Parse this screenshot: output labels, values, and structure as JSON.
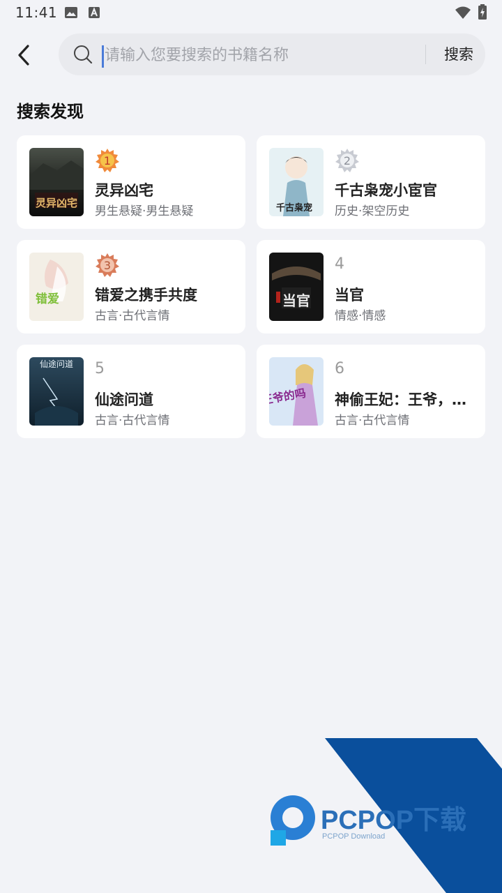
{
  "status_bar": {
    "time": "11:41"
  },
  "search": {
    "placeholder": "请输入您要搜索的书籍名称",
    "value": "",
    "button_label": "搜索"
  },
  "section_title": "搜索发现",
  "books": [
    {
      "rank": "1",
      "title": "灵异凶宅",
      "tags": "男生悬疑·男生悬疑",
      "cover_text": "灵异凶宅"
    },
    {
      "rank": "2",
      "title": "千古枭宠小宦官",
      "tags": "历史·架空历史",
      "cover_text": "千古枭宠"
    },
    {
      "rank": "3",
      "title": "错爱之携手共度",
      "tags": "古言·古代言情",
      "cover_text": "错爱"
    },
    {
      "rank": "4",
      "title": "当官",
      "tags": "情感·情感",
      "cover_text": "当官"
    },
    {
      "rank": "5",
      "title": "仙途问道",
      "tags": "古言·古代言情",
      "cover_text": "仙途问道"
    },
    {
      "rank": "6",
      "title": "神偷王妃：王爷，你好坏",
      "tags": "古言·古代言情",
      "cover_text": "王爷的吗"
    }
  ],
  "watermark": {
    "brand": "PCPOP下载",
    "sub": "PCPOP Download"
  },
  "colors": {
    "accent": "#4a7bd8",
    "watermark_blue": "#0a4f9c",
    "gold": "#e8a33c",
    "silver": "#b9bcc4",
    "bronze": "#d88c6c"
  }
}
